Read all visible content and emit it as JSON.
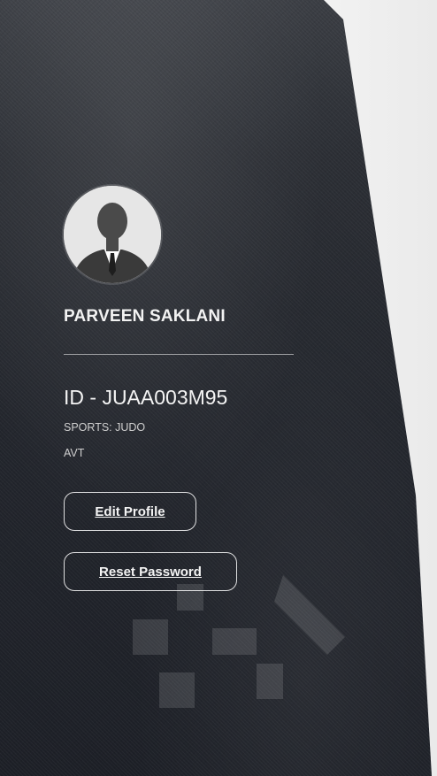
{
  "profile": {
    "name": "PARVEEN SAKLANI",
    "id_text": "ID - JUAA003M95",
    "sports_text": "SPORTS: JUDO",
    "unit_text": "AVT"
  },
  "actions": {
    "edit_profile_label": "Edit Profile",
    "reset_password_label": "Reset Password"
  },
  "icons": {
    "avatar": "user-silhouette-icon"
  }
}
